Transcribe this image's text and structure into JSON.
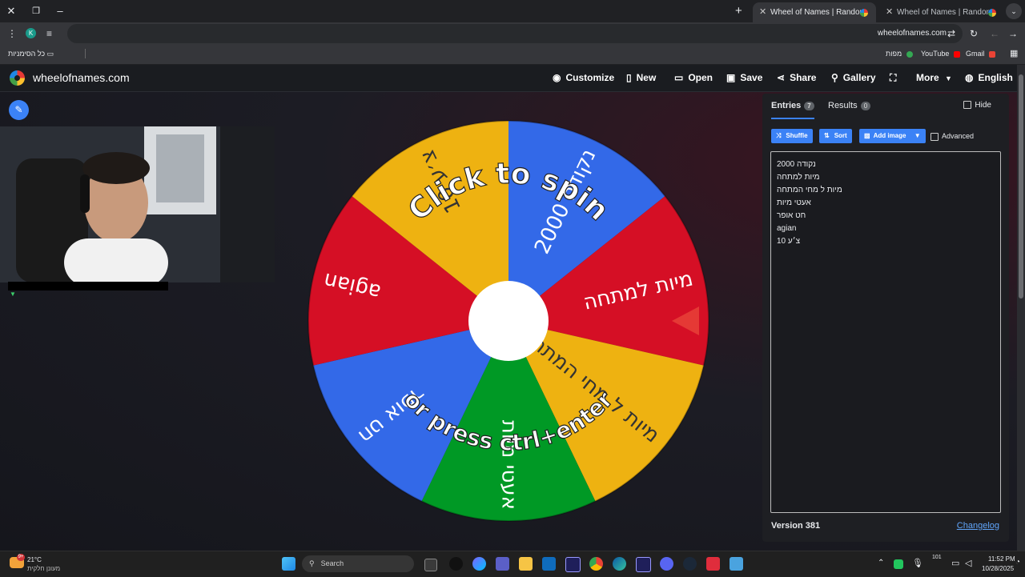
{
  "browser": {
    "tabs": [
      {
        "title": "Wheel of Names | Random nam",
        "active": true
      },
      {
        "title": "Wheel of Names | Random nam",
        "active": false
      }
    ],
    "url": "wheelofnames.com",
    "profile_initial": "K",
    "bookmarks": {
      "all_bookmarks": "כל הסימניות",
      "maps": "מפות",
      "youtube": "YouTube",
      "gmail": "Gmail"
    }
  },
  "site": {
    "name": "wheelofnames.com",
    "nav": {
      "customize": "Customize",
      "new": "New",
      "open": "Open",
      "save": "Save",
      "share": "Share",
      "gallery": "Gallery",
      "more": "More",
      "language": "English"
    },
    "wheel": {
      "prompt_top": "Click to spin",
      "prompt_bottom": "or press ctrl+enter",
      "segments": [
        {
          "label": "נקודה 2000",
          "color": "#3369e8"
        },
        {
          "label": "מיות למתחה",
          "color": "#d50f25"
        },
        {
          "label": "מיות ל מחי המתחה",
          "color": "#eeb211"
        },
        {
          "label": "אעטי מיות",
          "color": "#009925"
        },
        {
          "label": "חט אופר",
          "color": "#3369e8"
        },
        {
          "label": "agian",
          "color": "#d50f25"
        },
        {
          "label": "10 צ׳ע",
          "color": "#eeb211"
        }
      ]
    },
    "panel": {
      "tab_entries": "Entries",
      "entries_count": "7",
      "tab_results": "Results",
      "results_count": "0",
      "hide": "Hide",
      "shuffle": "Shuffle",
      "sort": "Sort",
      "add_image": "Add image",
      "advanced": "Advanced",
      "entries": [
        "נקודה 2000",
        "מיות למתחה",
        "מיות ל מחי המתחה",
        "אעטי מיות",
        "חט אופר",
        "agian",
        "10 צ׳ע"
      ],
      "version": "Version 381",
      "changelog": "Changelog"
    }
  },
  "taskbar": {
    "weather_temp": "21°C",
    "weather_desc": "מעונן חלקית",
    "search": "Search",
    "time": "11:52 PM",
    "date": "10/28/2025",
    "notif_count": "101"
  }
}
